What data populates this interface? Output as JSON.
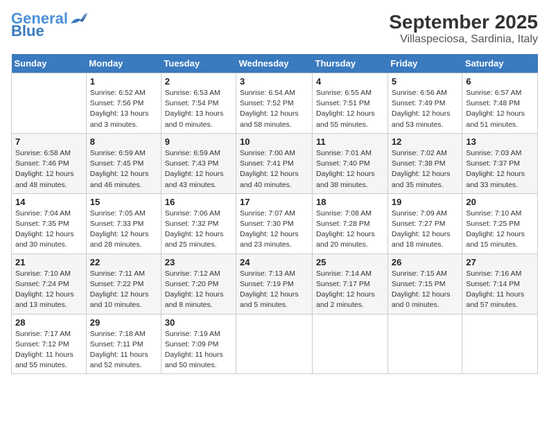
{
  "header": {
    "logo_general": "General",
    "logo_blue": "Blue",
    "title": "September 2025",
    "subtitle": "Villaspeciosa, Sardinia, Italy"
  },
  "calendar": {
    "days_of_week": [
      "Sunday",
      "Monday",
      "Tuesday",
      "Wednesday",
      "Thursday",
      "Friday",
      "Saturday"
    ],
    "weeks": [
      [
        {
          "day": "",
          "info": ""
        },
        {
          "day": "1",
          "info": "Sunrise: 6:52 AM\nSunset: 7:56 PM\nDaylight: 13 hours\nand 3 minutes."
        },
        {
          "day": "2",
          "info": "Sunrise: 6:53 AM\nSunset: 7:54 PM\nDaylight: 13 hours\nand 0 minutes."
        },
        {
          "day": "3",
          "info": "Sunrise: 6:54 AM\nSunset: 7:52 PM\nDaylight: 12 hours\nand 58 minutes."
        },
        {
          "day": "4",
          "info": "Sunrise: 6:55 AM\nSunset: 7:51 PM\nDaylight: 12 hours\nand 55 minutes."
        },
        {
          "day": "5",
          "info": "Sunrise: 6:56 AM\nSunset: 7:49 PM\nDaylight: 12 hours\nand 53 minutes."
        },
        {
          "day": "6",
          "info": "Sunrise: 6:57 AM\nSunset: 7:48 PM\nDaylight: 12 hours\nand 51 minutes."
        }
      ],
      [
        {
          "day": "7",
          "info": "Sunrise: 6:58 AM\nSunset: 7:46 PM\nDaylight: 12 hours\nand 48 minutes."
        },
        {
          "day": "8",
          "info": "Sunrise: 6:59 AM\nSunset: 7:45 PM\nDaylight: 12 hours\nand 46 minutes."
        },
        {
          "day": "9",
          "info": "Sunrise: 6:59 AM\nSunset: 7:43 PM\nDaylight: 12 hours\nand 43 minutes."
        },
        {
          "day": "10",
          "info": "Sunrise: 7:00 AM\nSunset: 7:41 PM\nDaylight: 12 hours\nand 40 minutes."
        },
        {
          "day": "11",
          "info": "Sunrise: 7:01 AM\nSunset: 7:40 PM\nDaylight: 12 hours\nand 38 minutes."
        },
        {
          "day": "12",
          "info": "Sunrise: 7:02 AM\nSunset: 7:38 PM\nDaylight: 12 hours\nand 35 minutes."
        },
        {
          "day": "13",
          "info": "Sunrise: 7:03 AM\nSunset: 7:37 PM\nDaylight: 12 hours\nand 33 minutes."
        }
      ],
      [
        {
          "day": "14",
          "info": "Sunrise: 7:04 AM\nSunset: 7:35 PM\nDaylight: 12 hours\nand 30 minutes."
        },
        {
          "day": "15",
          "info": "Sunrise: 7:05 AM\nSunset: 7:33 PM\nDaylight: 12 hours\nand 28 minutes."
        },
        {
          "day": "16",
          "info": "Sunrise: 7:06 AM\nSunset: 7:32 PM\nDaylight: 12 hours\nand 25 minutes."
        },
        {
          "day": "17",
          "info": "Sunrise: 7:07 AM\nSunset: 7:30 PM\nDaylight: 12 hours\nand 23 minutes."
        },
        {
          "day": "18",
          "info": "Sunrise: 7:08 AM\nSunset: 7:28 PM\nDaylight: 12 hours\nand 20 minutes."
        },
        {
          "day": "19",
          "info": "Sunrise: 7:09 AM\nSunset: 7:27 PM\nDaylight: 12 hours\nand 18 minutes."
        },
        {
          "day": "20",
          "info": "Sunrise: 7:10 AM\nSunset: 7:25 PM\nDaylight: 12 hours\nand 15 minutes."
        }
      ],
      [
        {
          "day": "21",
          "info": "Sunrise: 7:10 AM\nSunset: 7:24 PM\nDaylight: 12 hours\nand 13 minutes."
        },
        {
          "day": "22",
          "info": "Sunrise: 7:11 AM\nSunset: 7:22 PM\nDaylight: 12 hours\nand 10 minutes."
        },
        {
          "day": "23",
          "info": "Sunrise: 7:12 AM\nSunset: 7:20 PM\nDaylight: 12 hours\nand 8 minutes."
        },
        {
          "day": "24",
          "info": "Sunrise: 7:13 AM\nSunset: 7:19 PM\nDaylight: 12 hours\nand 5 minutes."
        },
        {
          "day": "25",
          "info": "Sunrise: 7:14 AM\nSunset: 7:17 PM\nDaylight: 12 hours\nand 2 minutes."
        },
        {
          "day": "26",
          "info": "Sunrise: 7:15 AM\nSunset: 7:15 PM\nDaylight: 12 hours\nand 0 minutes."
        },
        {
          "day": "27",
          "info": "Sunrise: 7:16 AM\nSunset: 7:14 PM\nDaylight: 11 hours\nand 57 minutes."
        }
      ],
      [
        {
          "day": "28",
          "info": "Sunrise: 7:17 AM\nSunset: 7:12 PM\nDaylight: 11 hours\nand 55 minutes."
        },
        {
          "day": "29",
          "info": "Sunrise: 7:18 AM\nSunset: 7:11 PM\nDaylight: 11 hours\nand 52 minutes."
        },
        {
          "day": "30",
          "info": "Sunrise: 7:19 AM\nSunset: 7:09 PM\nDaylight: 11 hours\nand 50 minutes."
        },
        {
          "day": "",
          "info": ""
        },
        {
          "day": "",
          "info": ""
        },
        {
          "day": "",
          "info": ""
        },
        {
          "day": "",
          "info": ""
        }
      ]
    ]
  }
}
